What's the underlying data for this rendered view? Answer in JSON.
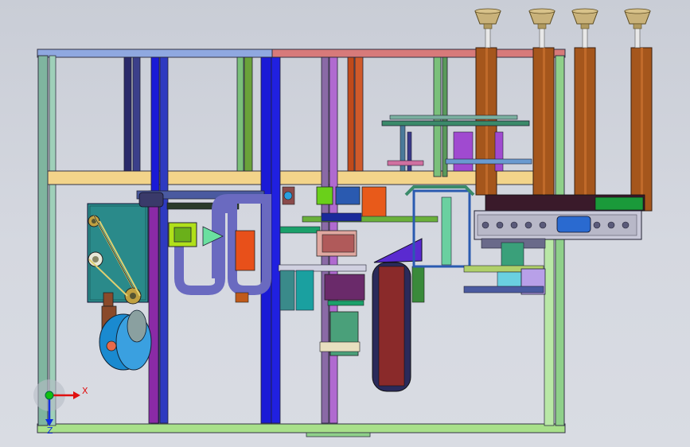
{
  "viewport": {
    "background_top": "#c9cdd6",
    "background_bottom": "#d9dce3"
  },
  "triad": {
    "x_label": "X",
    "z_label": "Z",
    "x_color": "#e01010",
    "y_color": "#10c010",
    "z_color": "#1030e0"
  },
  "model": {
    "frame_colors": {
      "top_rail_left": "#8fa8e0",
      "top_rail_right": "#d77a7a",
      "bottom_rail": "#a8e08a",
      "crossbar": "#f3d48a",
      "post_teal": "#7fb59f",
      "post_blue": "#1a1ad6",
      "post_navy": "#2a2a6a",
      "post_purple": "#8a2aa6",
      "post_rust": "#c04a1a",
      "post_green": "#7ac07a",
      "bronze_column": "#a5561c",
      "cup": "#c9b27a"
    }
  }
}
